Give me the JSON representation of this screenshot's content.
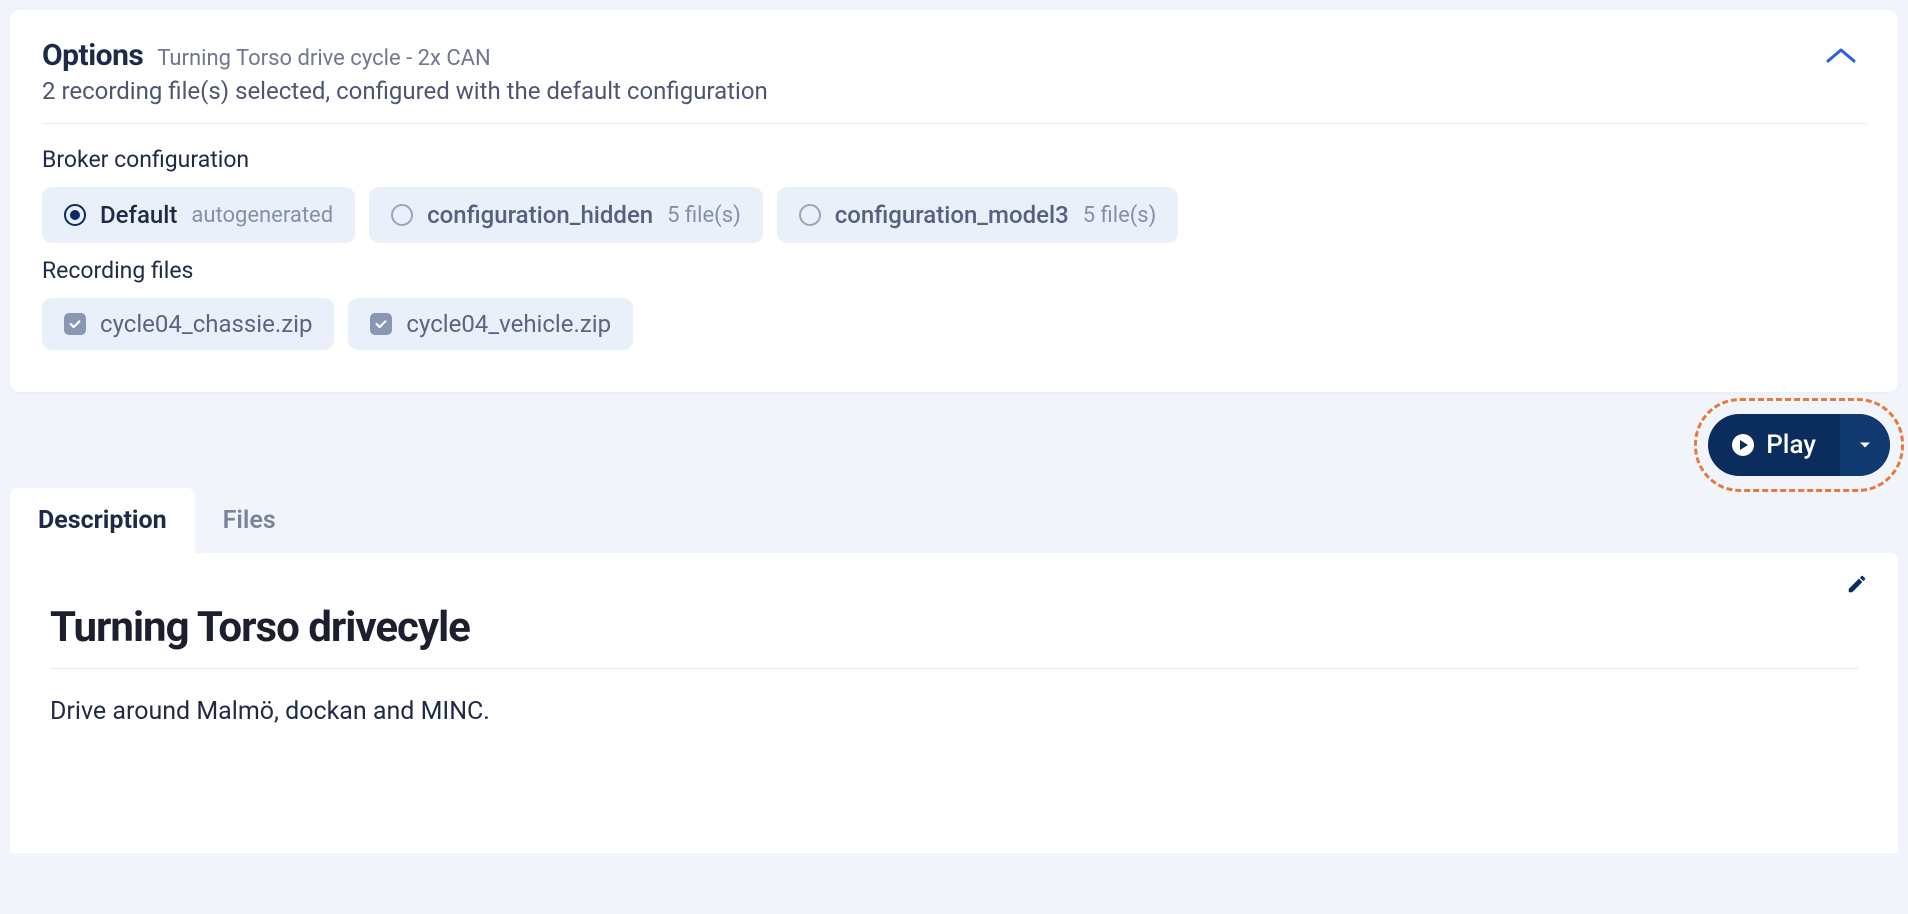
{
  "options": {
    "title": "Options",
    "subtitle": "Turning Torso drive cycle - 2x CAN",
    "summary": "2 recording file(s) selected, configured with the default configuration"
  },
  "broker": {
    "section_label": "Broker configuration",
    "configs": [
      {
        "label": "Default",
        "meta": "autogenerated",
        "selected": true
      },
      {
        "label": "configuration_hidden",
        "meta": "5 file(s)",
        "selected": false
      },
      {
        "label": "configuration_model3",
        "meta": "5 file(s)",
        "selected": false
      }
    ]
  },
  "recording": {
    "section_label": "Recording files",
    "files": [
      {
        "label": "cycle04_chassie.zip",
        "checked": true
      },
      {
        "label": "cycle04_vehicle.zip",
        "checked": true
      }
    ]
  },
  "play_button": {
    "label": "Play"
  },
  "tabs": [
    {
      "label": "Description",
      "active": true
    },
    {
      "label": "Files",
      "active": false
    }
  ],
  "description": {
    "title": "Turning Torso drivecyle",
    "body": "Drive around Malmö, dockan and MINC."
  }
}
